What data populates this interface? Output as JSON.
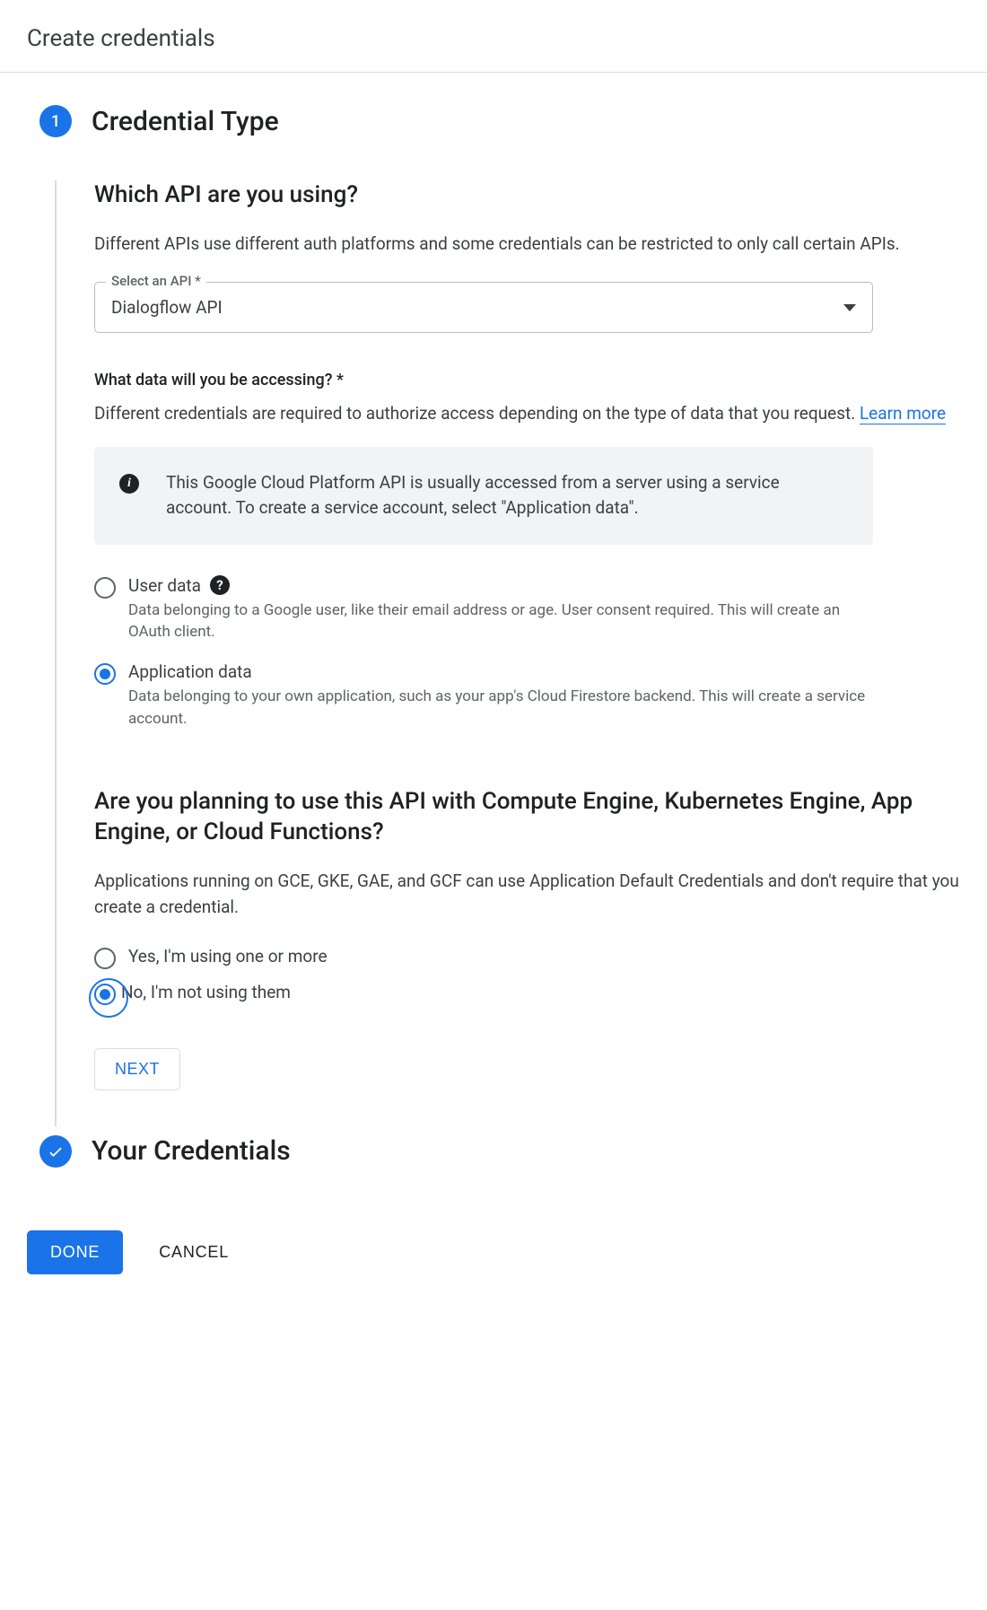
{
  "header": {
    "title": "Create credentials"
  },
  "step1": {
    "number": "1",
    "title": "Credential Type",
    "q1": {
      "heading": "Which API are you using?",
      "desc": "Different APIs use different auth platforms and some credentials can be restricted to only call certain APIs.",
      "select_label": "Select an API *",
      "select_value": "Dialogflow API"
    },
    "q2": {
      "label": "What data will you be accessing? *",
      "desc_prefix": "Different credentials are required to authorize access depending on the type of data that you request. ",
      "learn_more": "Learn more",
      "info": "This Google Cloud Platform API is usually accessed from a server using a service account. To create a service account, select \"Application data\".",
      "options": [
        {
          "label": "User data",
          "sub": "Data belonging to a Google user, like their email address or age. User consent required. This will create an OAuth client.",
          "selected": false,
          "help": true
        },
        {
          "label": "Application data",
          "sub": "Data belonging to your own application, such as your app's Cloud Firestore backend. This will create a service account.",
          "selected": true,
          "help": false
        }
      ]
    },
    "q3": {
      "heading": "Are you planning to use this API with Compute Engine, Kubernetes Engine, App Engine, or Cloud Functions?",
      "desc": "Applications running on GCE, GKE, GAE, and GCF can use Application Default Credentials and don't require that you create a credential.",
      "options": [
        {
          "label": "Yes, I'm using one or more",
          "selected": false,
          "focus": false
        },
        {
          "label": "No, I'm not using them",
          "selected": true,
          "focus": true
        }
      ]
    },
    "next_label": "NEXT"
  },
  "step2": {
    "title": "Your Credentials"
  },
  "actions": {
    "done": "DONE",
    "cancel": "CANCEL"
  }
}
